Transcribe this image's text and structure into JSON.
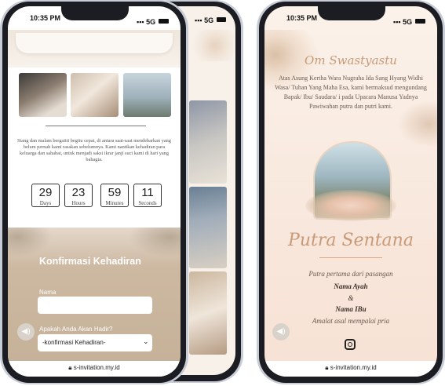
{
  "left_phone": {
    "status": {
      "time": "10:35 PM",
      "network": "5G"
    },
    "intro_text": "Siang dan malam bergaitti begitu cepat, di antara saat-saat mendebarkan yang belum pernah kami rasakan sebelumnya. Kami nantikan kehadiran para keluarga dan sahabat, untuk menjadi saksi ikrar janji suci kami di hari yang bahagia.",
    "countdown": [
      {
        "value": "29",
        "label": "Days"
      },
      {
        "value": "23",
        "label": "Hours"
      },
      {
        "value": "59",
        "label": "Minutes"
      },
      {
        "value": "11",
        "label": "Seconds"
      }
    ],
    "rsvp": {
      "title": "Konfirmasi Kehadiran",
      "name_label": "Nama",
      "name_value": "",
      "attend_label": "Apakah Anda Akan Hadir?",
      "attend_selected": "-konfirmasi Kehadiran-"
    },
    "url": "s-invitation.my.id"
  },
  "middle_phone": {
    "status": {
      "network": "5G"
    }
  },
  "right_phone": {
    "status": {
      "time": "10:35 PM",
      "network": "5G"
    },
    "greeting": "Om Swastyastu",
    "intro_text": "Atas Asung Kertha Wara Nugraha Ida Sang Hyang Widhi Wasa/ Tuhan Yang Maha Esa, kami bermaksud mengundang Bapak/ Ibu/ Saudara/ i pada Upacara Manusa Yadnya Pawiwahan putra dan putri kami.",
    "groom_name": "Putra Sentana",
    "parents_intro": "Putra pertama dari pasangan",
    "father": "Nama Ayah",
    "ampersand": "&",
    "mother": "Nama IBu",
    "origin": "Amalat asal mempalai pria",
    "url": "s-invitation.my.id"
  },
  "colors": {
    "accent": "#c89a78",
    "frame": "#1c1d22",
    "rsvp_bg": "#c9b39a"
  }
}
